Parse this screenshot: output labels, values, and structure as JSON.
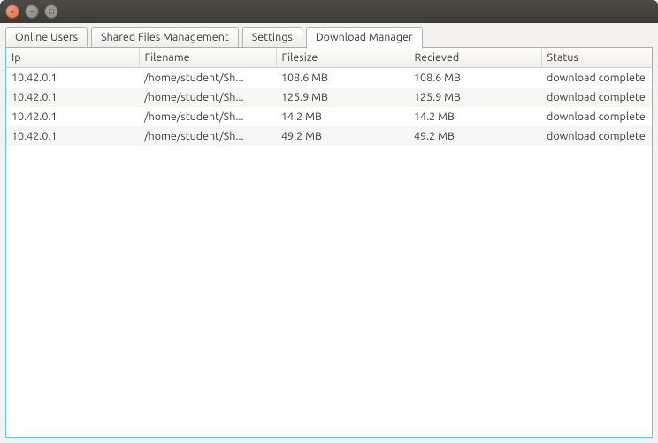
{
  "window": {
    "close_glyph": "×",
    "min_glyph": "–",
    "max_glyph": "□"
  },
  "tabs": {
    "online_users": "Online Users",
    "shared_files": "Shared Files Management",
    "settings": "Settings",
    "download_manager": "Download Manager"
  },
  "columns": {
    "ip": "Ip",
    "filename": "Filename",
    "filesize": "Filesize",
    "recieved": "Recieved",
    "status": "Status"
  },
  "rows": [
    {
      "ip": "10.42.0.1",
      "filename": "/home/student/Sh...",
      "filesize": "108.6 MB",
      "recieved": "108.6 MB",
      "status": "download complete"
    },
    {
      "ip": "10.42.0.1",
      "filename": "/home/student/Sh...",
      "filesize": "125.9 MB",
      "recieved": "125.9 MB",
      "status": "download complete"
    },
    {
      "ip": "10.42.0.1",
      "filename": "/home/student/Sh...",
      "filesize": "14.2 MB",
      "recieved": "14.2 MB",
      "status": "download complete"
    },
    {
      "ip": "10.42.0.1",
      "filename": "/home/student/Sh...",
      "filesize": "49.2 MB",
      "recieved": "49.2 MB",
      "status": "download complete"
    }
  ]
}
